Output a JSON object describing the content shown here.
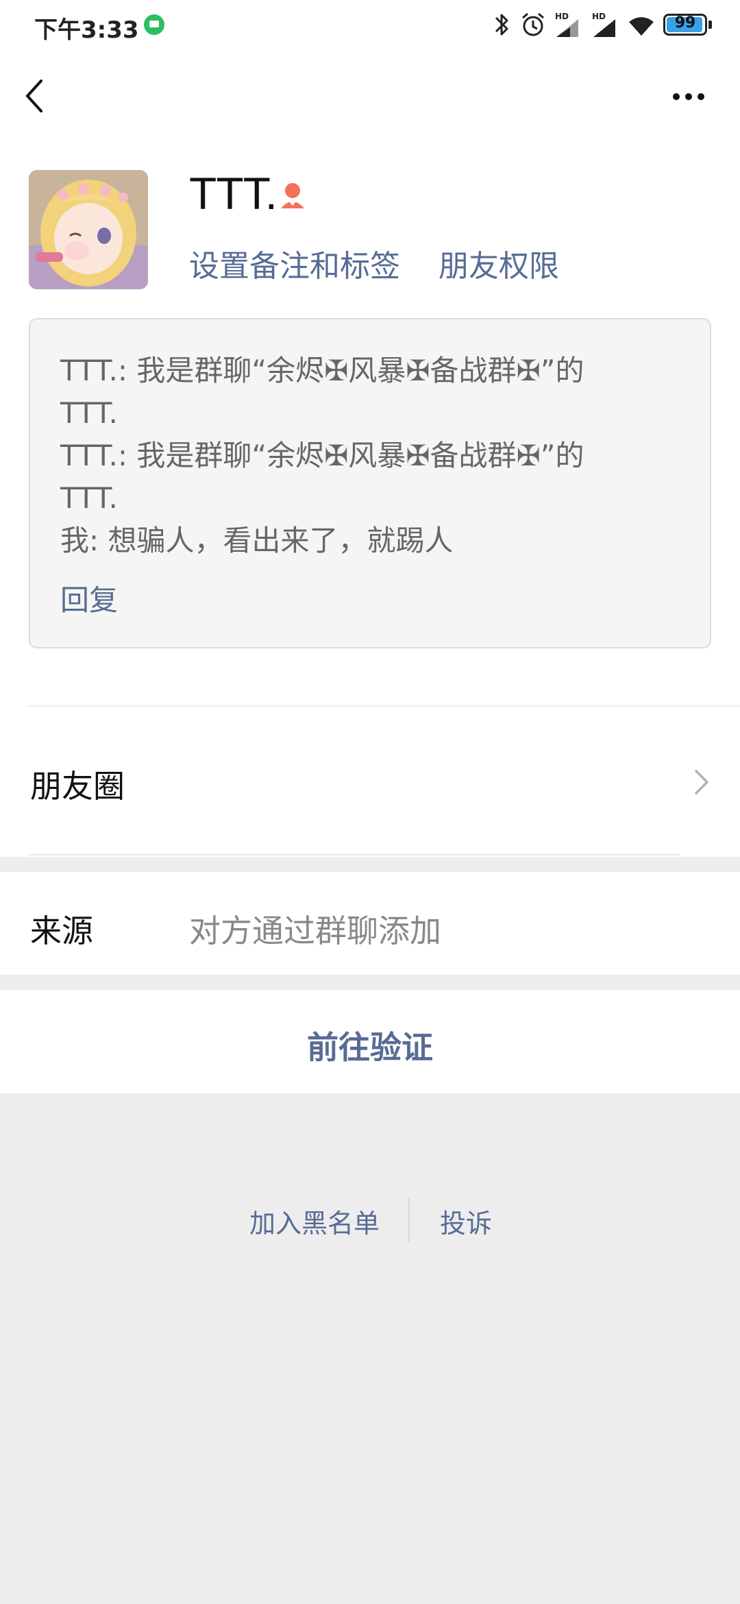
{
  "status_bar": {
    "time": "下午3:33",
    "battery": "99",
    "icons": [
      "message-icon",
      "bluetooth-icon",
      "alarm-icon",
      "signal-hd-icon",
      "signal-hd-icon",
      "wifi-icon",
      "battery-icon"
    ],
    "hd_label": "HD"
  },
  "nav": {
    "back_icon": "chevron-left-icon",
    "more_icon": "more-dots-icon"
  },
  "profile": {
    "name": "TTT.",
    "gender_icon": "female-icon",
    "set_remark_label": "设置备注和标签",
    "friend_permissions_label": "朋友权限"
  },
  "message_box": {
    "lines": [
      "TTT.: 我是群聊“余烬✠风暴✠备战群✠”的",
      "TTT.",
      "TTT.: 我是群聊“余烬✠风暴✠备战群✠”的",
      "TTT.",
      "我: 想骗人，看出来了，就踢人"
    ],
    "reply_label": "回复"
  },
  "moments": {
    "label": "朋友圈"
  },
  "source": {
    "label": "来源",
    "value": "对方通过群聊添加"
  },
  "verify": {
    "label": "前往验证"
  },
  "bottom": {
    "blacklist_label": "加入黑名单",
    "report_label": "投诉"
  },
  "colors": {
    "link": "#576b95",
    "background": "#ededed",
    "gender_icon": "#f0735a",
    "battery_fill": "#3aa0e8"
  }
}
